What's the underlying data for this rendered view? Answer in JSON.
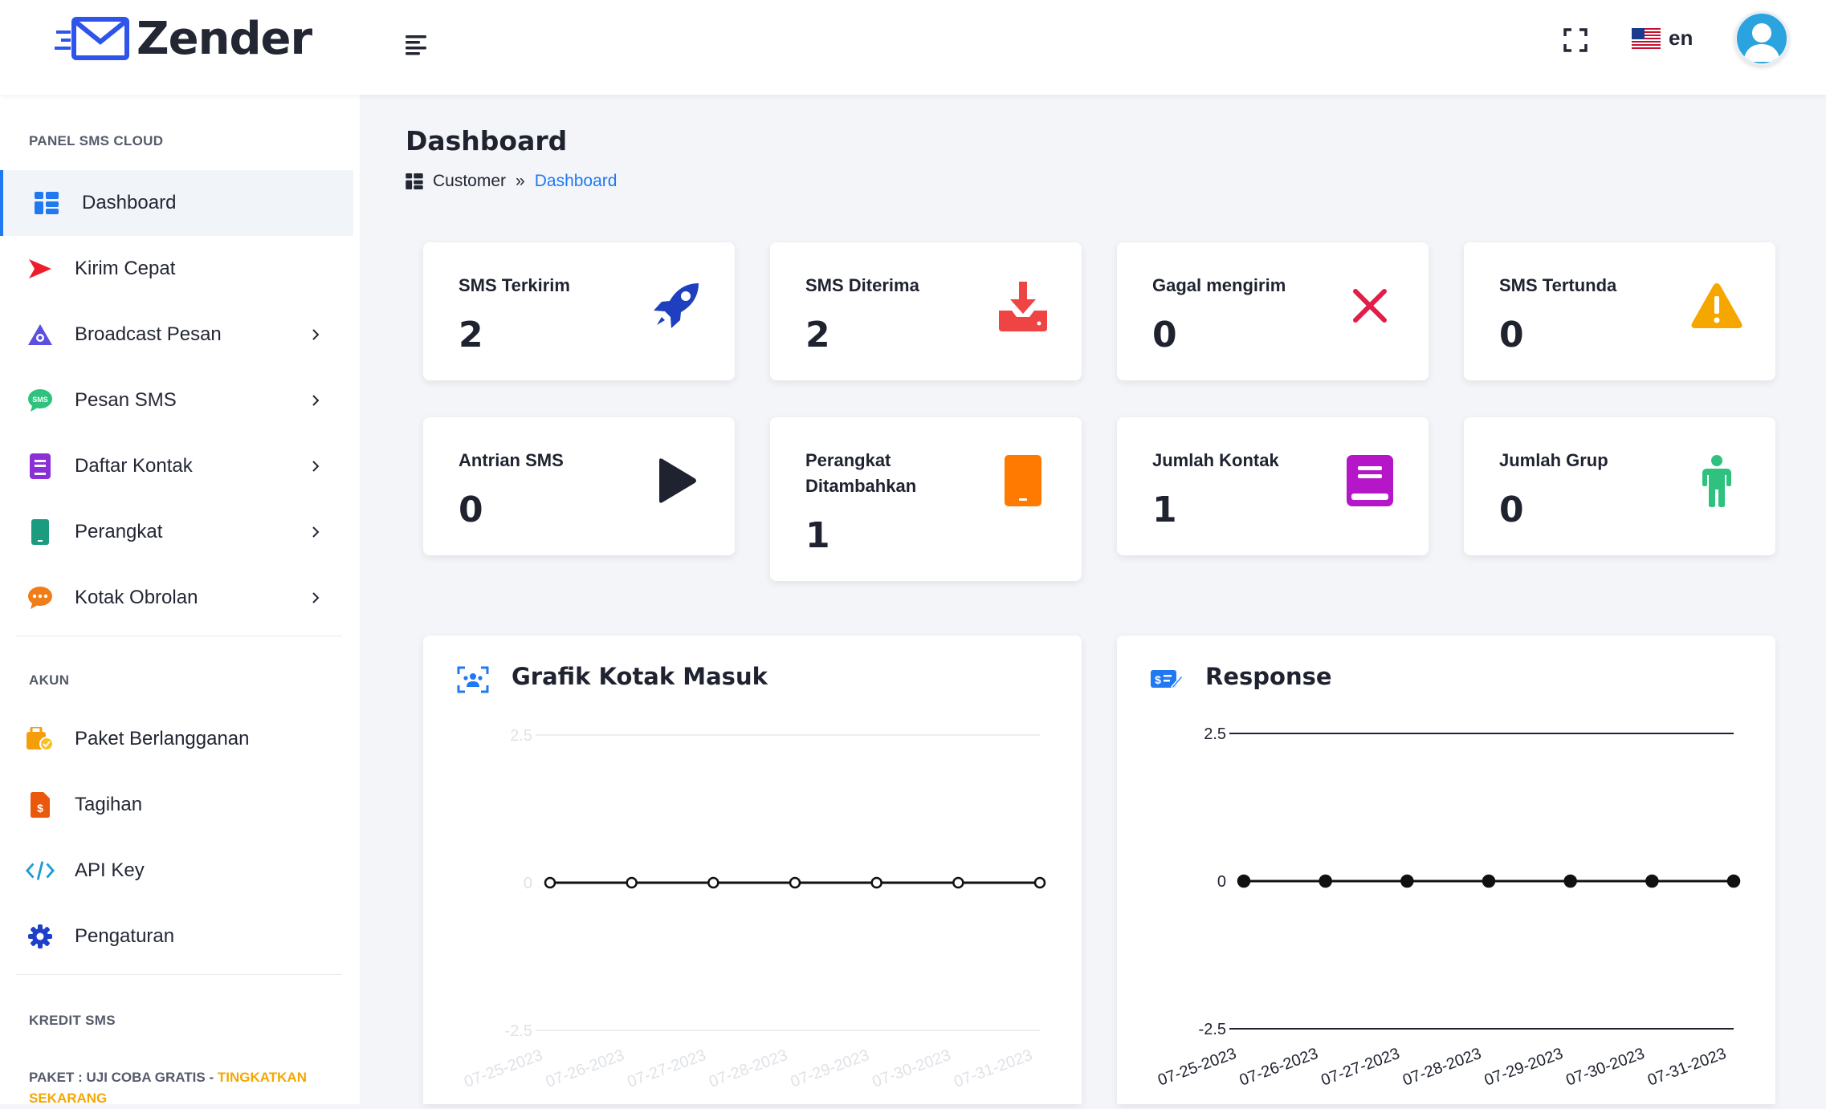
{
  "app": {
    "name": "Zender"
  },
  "header": {
    "language": "en",
    "colors": {
      "brand": "#2079f0"
    }
  },
  "sidebar": {
    "section_panel": "PANEL SMS CLOUD",
    "items": [
      {
        "label": "Dashboard",
        "icon": "dashboard-icon",
        "active": true
      },
      {
        "label": "Kirim Cepat",
        "icon": "send-icon"
      },
      {
        "label": "Broadcast Pesan",
        "icon": "broadcast-icon"
      },
      {
        "label": "Pesan SMS",
        "icon": "sms-icon"
      },
      {
        "label": "Daftar Kontak",
        "icon": "contacts-icon"
      },
      {
        "label": "Perangkat",
        "icon": "device-icon"
      },
      {
        "label": "Kotak Obrolan",
        "icon": "chat-icon"
      }
    ],
    "section_account": "AKUN",
    "account_items": [
      {
        "label": "Paket Berlangganan",
        "icon": "package-icon"
      },
      {
        "label": "Tagihan",
        "icon": "invoice-icon"
      },
      {
        "label": "API Key",
        "icon": "code-icon"
      },
      {
        "label": "Pengaturan",
        "icon": "gear-icon"
      }
    ],
    "section_credit": "KREDIT SMS",
    "credit_prefix": "PAKET : UJI COBA GRATIS - ",
    "credit_upgrade": "TINGKATKAN SEKARANG"
  },
  "main": {
    "title": "Dashboard",
    "breadcrumb": {
      "root": "Customer",
      "separator": "»",
      "current": "Dashboard"
    },
    "stats": [
      {
        "title": "SMS Terkirim",
        "value": "2",
        "icon": "rocket-icon",
        "color": "#1e3fbf"
      },
      {
        "title": "SMS Diterima",
        "value": "2",
        "icon": "inbox-download-icon",
        "color": "#ef4444"
      },
      {
        "title": "Gagal mengirim",
        "value": "0",
        "icon": "close-icon",
        "color": "#e11d48"
      },
      {
        "title": "SMS Tertunda",
        "value": "0",
        "icon": "warning-icon",
        "color": "#f5a700"
      },
      {
        "title": "Antrian SMS",
        "value": "0",
        "icon": "play-icon",
        "color": "#1f2330"
      },
      {
        "title": "Perangkat Ditambahkan",
        "value": "1",
        "icon": "tablet-icon",
        "color": "#ff7a00"
      },
      {
        "title": "Jumlah Kontak",
        "value": "1",
        "icon": "book-icon",
        "color": "#b517c8"
      },
      {
        "title": "Jumlah Grup",
        "value": "0",
        "icon": "person-icon",
        "color": "#2ec27e"
      }
    ]
  },
  "chart_data": [
    {
      "type": "line",
      "title": "Grafik Kotak Masuk",
      "icon": "group-icon",
      "x": [
        "07-25-2023",
        "07-26-2023",
        "07-27-2023",
        "07-28-2023",
        "07-29-2023",
        "07-30-2023",
        "07-31-2023"
      ],
      "series": [
        {
          "values": [
            0,
            0,
            0,
            0,
            0,
            0,
            0
          ]
        }
      ],
      "ylim": [
        -2.5,
        2.5
      ],
      "yticks": [
        "2.5",
        "0",
        "-2.5"
      ],
      "faded_axes": true,
      "marker": "hollow"
    },
    {
      "type": "line",
      "title": "Response",
      "icon": "payment-icon",
      "x": [
        "07-25-2023",
        "07-26-2023",
        "07-27-2023",
        "07-28-2023",
        "07-29-2023",
        "07-30-2023",
        "07-31-2023"
      ],
      "series": [
        {
          "values": [
            0,
            0,
            0,
            0,
            0,
            0,
            0
          ]
        }
      ],
      "ylim": [
        -2.5,
        2.5
      ],
      "yticks": [
        "2.5",
        "0",
        "-2.5"
      ],
      "faded_axes": false,
      "marker": "filled"
    }
  ]
}
